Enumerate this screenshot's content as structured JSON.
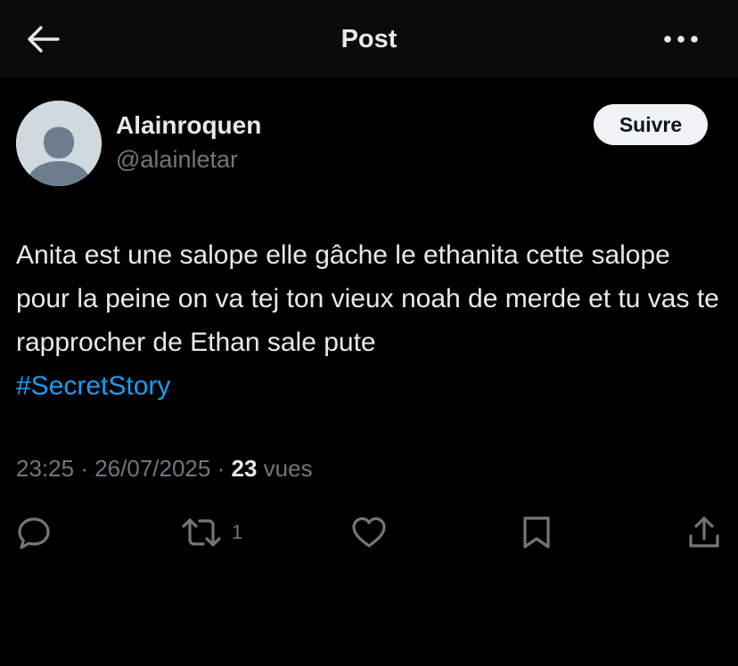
{
  "header": {
    "title": "Post",
    "back_icon": "arrow-left-icon",
    "more_icon": "more-horizontal-icon"
  },
  "author": {
    "display_name": "Alainroquen",
    "handle": "@alainletar",
    "avatar": "default-avatar",
    "follow_label": "Suivre"
  },
  "tweet": {
    "text": "Anita est une salope elle gâche le ethanita cette salope pour la peine on va tej ton vieux noah de merde et tu vas te rapprocher de Ethan sale pute",
    "hashtag": "#SecretStory"
  },
  "meta": {
    "time": "23:25",
    "separator": "·",
    "date": "26/07/2025",
    "views_count": "23",
    "views_label": "vues"
  },
  "actions": {
    "reply_icon": "reply-icon",
    "retweet_icon": "retweet-icon",
    "retweet_count": "1",
    "like_icon": "heart-icon",
    "bookmark_icon": "bookmark-icon",
    "share_icon": "share-icon"
  },
  "colors": {
    "background": "#000000",
    "header_background": "#0b0b0b",
    "text_primary": "#e7e9ea",
    "text_secondary": "#71767b",
    "link": "#1d9bf0",
    "follow_button": "#eff3f4"
  }
}
